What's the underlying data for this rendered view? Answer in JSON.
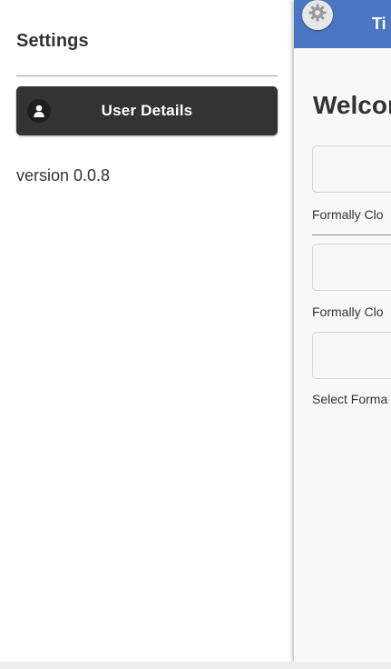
{
  "drawer": {
    "title": "Settings",
    "user_details_button": {
      "label": "User Details",
      "icon": "user-icon"
    },
    "version": "version 0.0.8"
  },
  "main": {
    "header": {
      "settings_icon": "gear-icon",
      "title": "Ti",
      "background_color": "#4a76c2"
    },
    "welcome_text": "Welcon",
    "fields": [
      {
        "caption": "Formally Clo"
      },
      {
        "caption": "Formally Clo"
      },
      {
        "caption": "Select Forma"
      }
    ]
  },
  "colors": {
    "button_dark": "#333333",
    "text": "#333333",
    "header_blue": "#4a76c2"
  }
}
